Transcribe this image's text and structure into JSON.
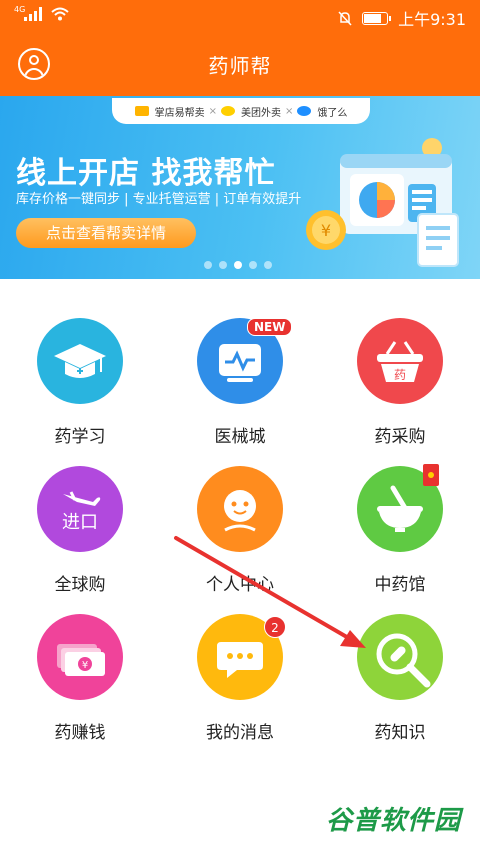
{
  "status_bar": {
    "network": "4G",
    "time": "上午9:31"
  },
  "header": {
    "title": "药师帮"
  },
  "banner": {
    "partners": [
      "掌店易帮卖",
      "美团外卖",
      "饿了么"
    ],
    "partner_separator": "×",
    "headline": "线上开店 找我帮忙",
    "subtitle": "库存价格一键同步 | 专业托管运营 | 订单有效提升",
    "cta": "点击查看帮卖详情",
    "page_count": 5,
    "active_page": 3,
    "illustration_icon": "store-window-chart-icon",
    "coin_symbol": "¥"
  },
  "grid": {
    "items": [
      {
        "label": "药学习",
        "icon": "graduation-cap-icon",
        "color": "#29b4df"
      },
      {
        "label": "医械城",
        "icon": "monitor-device-icon",
        "color": "#2f8ee8",
        "badge": "NEW"
      },
      {
        "label": "药采购",
        "icon": "basket-icon",
        "color": "#f0484c",
        "icon_text": "药"
      },
      {
        "label": "全球购",
        "icon": "airplane-icon",
        "color": "#b149dd",
        "icon_text": "进口"
      },
      {
        "label": "个人中心",
        "icon": "person-icon",
        "color": "#ff8c1e"
      },
      {
        "label": "中药馆",
        "icon": "mortar-bowl-icon",
        "color": "#5fca43",
        "badge_icon": "red-packet-icon"
      },
      {
        "label": "药赚钱",
        "icon": "money-icon",
        "color": "#f0439a",
        "icon_text": "¥"
      },
      {
        "label": "我的消息",
        "icon": "chat-bubble-icon",
        "color": "#ffb90d",
        "badge": "2"
      },
      {
        "label": "药知识",
        "icon": "magnifier-pill-icon",
        "color": "#8ed43a"
      }
    ]
  },
  "annotation": {
    "type": "arrow",
    "color": "#e8322f",
    "points_to": "药知识"
  },
  "watermark": {
    "part_a": "谷普",
    "part_b": "软件园"
  }
}
